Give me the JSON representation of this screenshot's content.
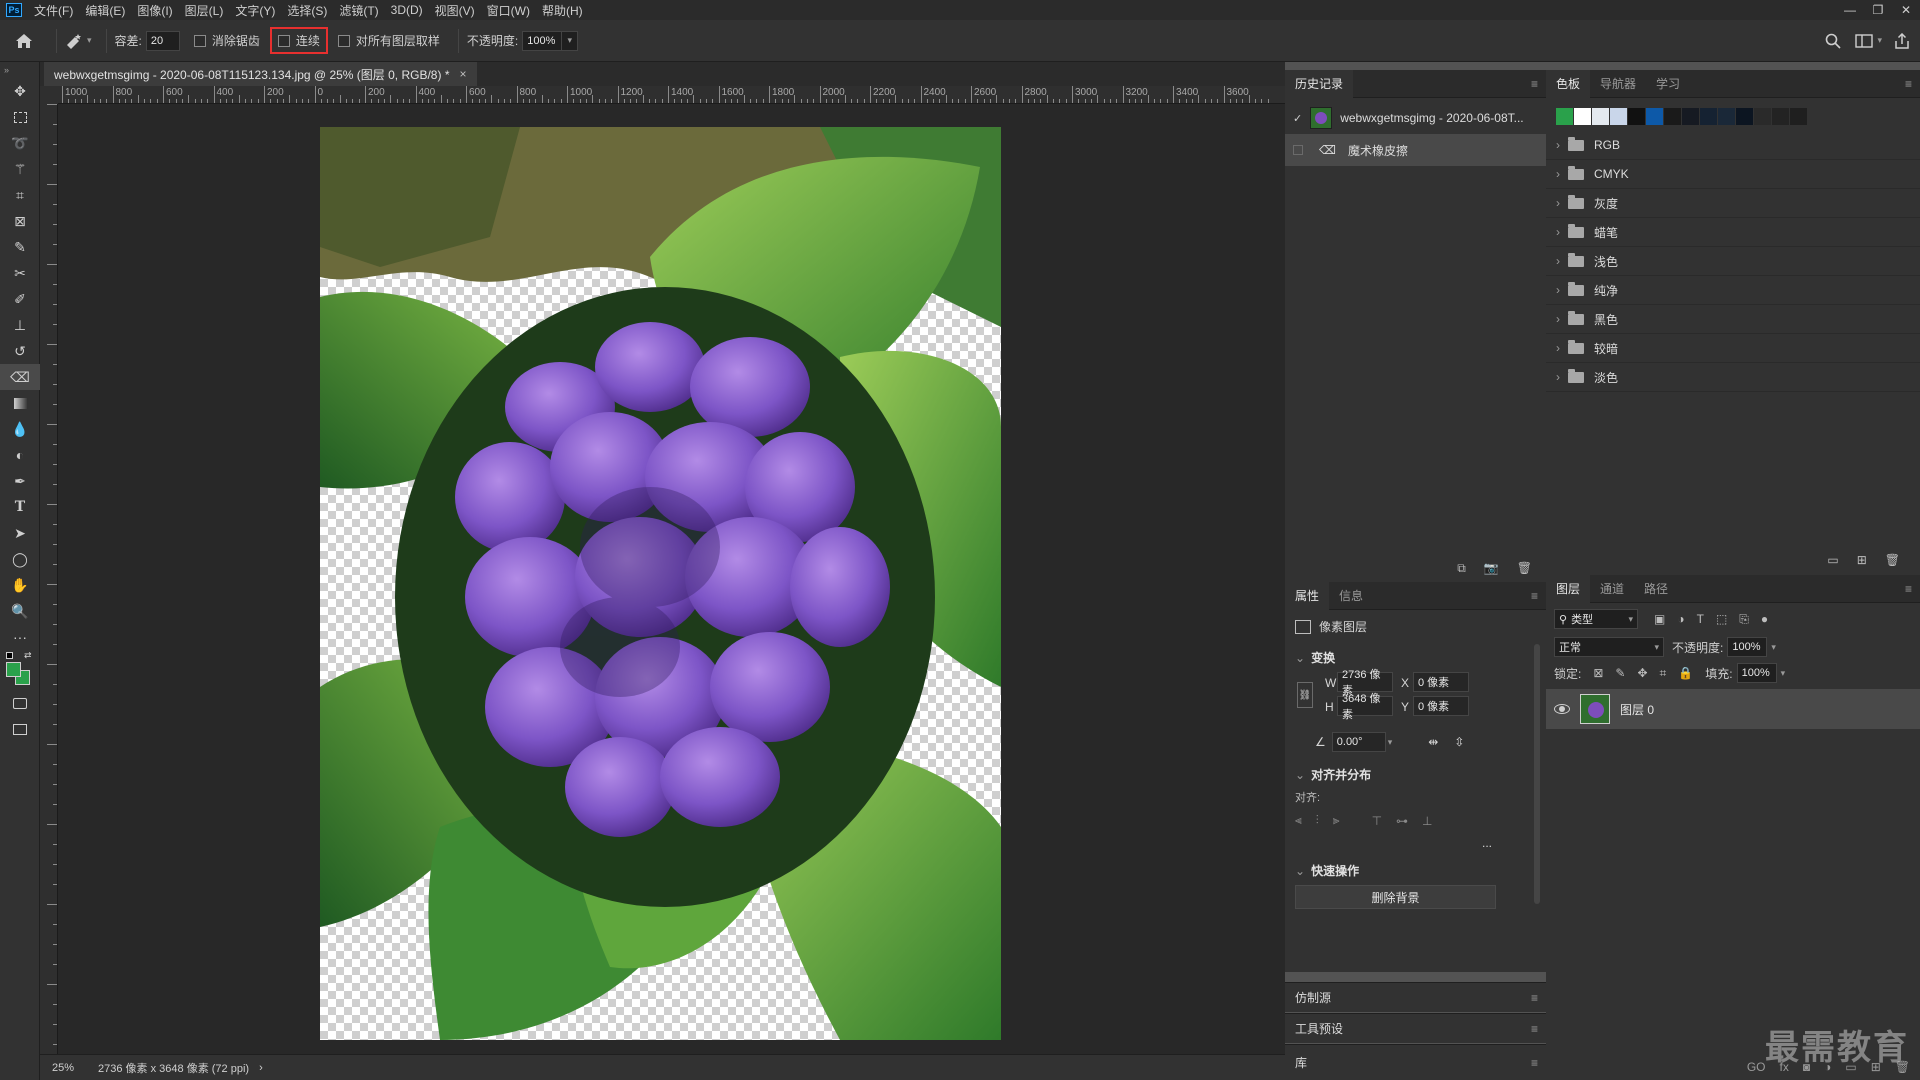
{
  "menu": {
    "app_logo": "Ps",
    "items": [
      "文件(F)",
      "编辑(E)",
      "图像(I)",
      "图层(L)",
      "文字(Y)",
      "选择(S)",
      "滤镜(T)",
      "3D(D)",
      "视图(V)",
      "窗口(W)",
      "帮助(H)"
    ],
    "window_controls": [
      "—",
      "❐",
      "✕"
    ]
  },
  "options": {
    "tolerance_label": "容差:",
    "tolerance_value": "20",
    "antialias_label": "消除锯齿",
    "contiguous_label": "连续",
    "sample_all_label": "对所有图层取样",
    "opacity_label": "不透明度:",
    "opacity_value": "100%"
  },
  "document": {
    "tab_title": "webwxgetmsgimg - 2020-06-08T115123.134.jpg @ 25% (图层 0, RGB/8) *",
    "close": "×"
  },
  "ruler": {
    "h_labels": [
      "1000",
      "800",
      "600",
      "400",
      "200",
      "0",
      "200",
      "400",
      "600",
      "800",
      "1000",
      "1200",
      "1400",
      "1600",
      "1800",
      "2000",
      "2200",
      "2400",
      "2600",
      "2800",
      "3000",
      "3200",
      "3400",
      "3600"
    ]
  },
  "status": {
    "zoom": "25%",
    "dimensions": "2736 像素 x 3648 像素 (72 ppi)",
    "arrow": "›"
  },
  "history": {
    "tab": "历史记录",
    "snapshot_label": "webwxgetmsgimg - 2020-06-08T...",
    "step_label": "魔术橡皮擦"
  },
  "properties": {
    "tabs": [
      "属性",
      "信息"
    ],
    "layer_type": "像素图层",
    "transform_title": "变换",
    "w_label": "W",
    "w_value": "2736 像素",
    "h_label": "H",
    "h_value": "3648 像素",
    "x_label": "X",
    "x_value": "0 像素",
    "y_label": "Y",
    "y_value": "0 像素",
    "angle_value": "0.00°",
    "align_title": "对齐并分布",
    "align_label": "对齐:",
    "more": "...",
    "quick_title": "快速操作",
    "remove_bg_button": "删除背景"
  },
  "collapsed": {
    "clone_source": "仿制源",
    "tool_presets": "工具预设",
    "library": "库"
  },
  "swatches": {
    "tabs": [
      "色板",
      "导航器",
      "学习"
    ],
    "colors": [
      "#2aa14b",
      "#ffffff",
      "#e4e9ef",
      "#c9d6ea",
      "#111111",
      "#0d59a8",
      "#1a1a1a",
      "#161a22",
      "#152232",
      "#1a2838",
      "#0c1521",
      "#2a2a2a",
      "#232323",
      "#1f1f1f"
    ],
    "folders": [
      "RGB",
      "CMYK",
      "灰度",
      "蜡笔",
      "浅色",
      "纯净",
      "黑色",
      "较暗",
      "淡色"
    ]
  },
  "layers": {
    "tabs": [
      "图层",
      "通道",
      "路径"
    ],
    "filter_label": "类型",
    "blend_mode": "正常",
    "opacity_label": "不透明度:",
    "opacity_value": "100%",
    "lock_label": "锁定:",
    "fill_label": "填充:",
    "fill_value": "100%",
    "layer_name": "图层 0",
    "footer_icons": [
      "GO",
      "fx"
    ]
  },
  "watermark": "最需教育"
}
